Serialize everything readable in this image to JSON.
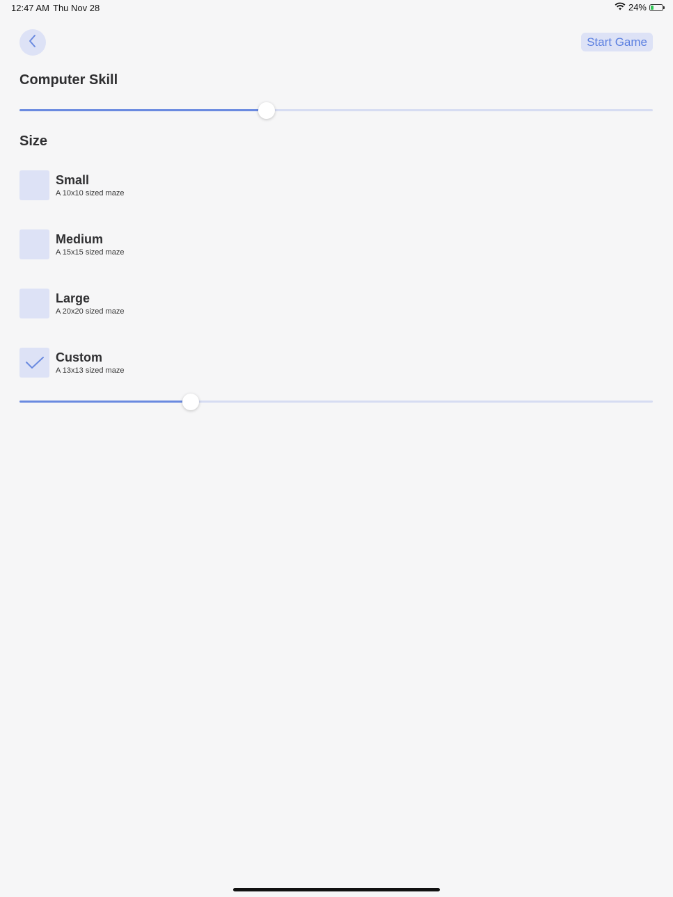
{
  "status_bar": {
    "time": "12:47 AM",
    "date": "Thu Nov 28",
    "battery_percent": "24%",
    "battery_level": 0.24
  },
  "nav": {
    "back_icon": "chevron-left-icon",
    "start_label": "Start Game"
  },
  "skill": {
    "title": "Computer Skill",
    "value": 0.39
  },
  "size": {
    "title": "Size",
    "options": [
      {
        "title": "Small",
        "subtitle": "A 10x10 sized maze",
        "checked": false
      },
      {
        "title": "Medium",
        "subtitle": "A 15x15 sized maze",
        "checked": false
      },
      {
        "title": "Large",
        "subtitle": "A 20x20 sized maze",
        "checked": false
      },
      {
        "title": "Custom",
        "subtitle": "A 13x13 sized maze",
        "checked": true
      }
    ],
    "custom_value": 0.27
  },
  "colors": {
    "accent": "#6a8ae0",
    "accent_light": "#dde2f6",
    "background": "#f6f6f7"
  }
}
